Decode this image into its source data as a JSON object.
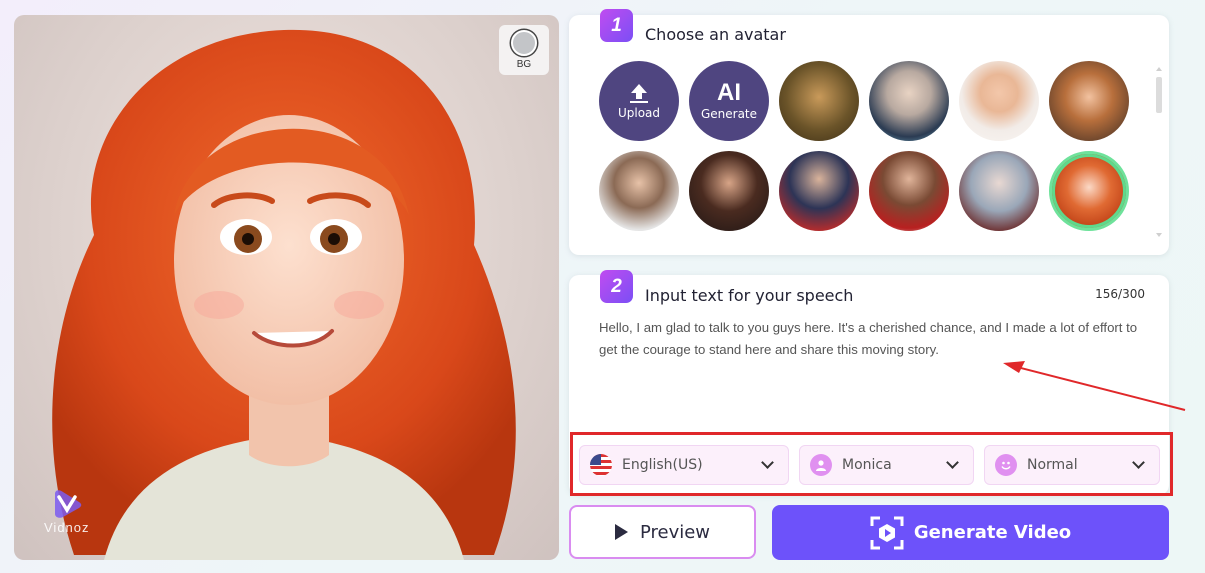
{
  "preview": {
    "bg_button_label": "BG",
    "watermark": "Vidnoz"
  },
  "step1": {
    "number": "1",
    "title": "Choose an avatar",
    "upload_label": "Upload",
    "ai_label": "AI",
    "generate_label": "Generate",
    "avatars": [
      {
        "name": "mona-lisa",
        "selected": false
      },
      {
        "name": "einstein",
        "selected": false
      },
      {
        "name": "cartoon-man",
        "selected": false
      },
      {
        "name": "cartoon-woman-brunette",
        "selected": false
      },
      {
        "name": "cartoon-man-white-shirt",
        "selected": false
      },
      {
        "name": "wonder-woman",
        "selected": false
      },
      {
        "name": "superman",
        "selected": false
      },
      {
        "name": "iron-man-elon",
        "selected": false
      },
      {
        "name": "harley-quinn",
        "selected": false
      },
      {
        "name": "redhead-girl",
        "selected": true
      }
    ]
  },
  "step2": {
    "number": "2",
    "title": "Input text for your speech",
    "counter": "156/300",
    "text": "Hello, I am glad to talk to you guys here. It's a cherished chance, and I made a lot of effort to get the courage to stand here and share this moving story."
  },
  "selects": {
    "language": "English(US)",
    "voice": "Monica",
    "emotion": "Normal"
  },
  "buttons": {
    "preview": "Preview",
    "generate": "Generate Video"
  },
  "colors": {
    "accent": "#6d52fa",
    "action_avatar": "#4f4580",
    "selected_ring": "#6ee29b",
    "highlight": "#e0282a"
  }
}
